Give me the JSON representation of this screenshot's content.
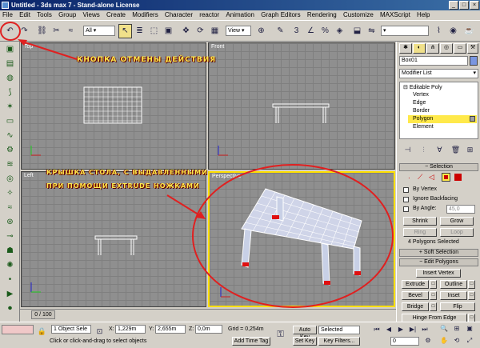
{
  "window": {
    "title": "Untitled - 3ds max 7 - Stand-alone License"
  },
  "menu": [
    "File",
    "Edit",
    "Tools",
    "Group",
    "Views",
    "Create",
    "Modifiers",
    "Character",
    "reactor",
    "Animation",
    "Graph Editors",
    "Rendering",
    "Customize",
    "MAXScript",
    "Help"
  ],
  "toolbar": {
    "selection_filter": "All",
    "ref_coord": "View"
  },
  "viewports": {
    "top": "Top",
    "front": "Front",
    "left": "Left",
    "perspective": "Perspective"
  },
  "annotations": {
    "undo_note": "КНОПКА ОТМЕНЫ ДЕЙСТВИЯ",
    "table_note_line1": "КРЫШКА СТОЛА, С ВЫДАВЛЕННЫМИ",
    "table_note_line2": "ПРИ ПОМОЩИ EXTRUDE НОЖКАМИ"
  },
  "command_panel": {
    "object_name": "Box01",
    "modifier_list": "Modifier List",
    "stack": [
      {
        "label": "Editable Poly",
        "level": 0,
        "selected": false
      },
      {
        "label": "Vertex",
        "level": 1,
        "selected": false
      },
      {
        "label": "Edge",
        "level": 1,
        "selected": false
      },
      {
        "label": "Border",
        "level": 1,
        "selected": false
      },
      {
        "label": "Polygon",
        "level": 1,
        "selected": true
      },
      {
        "label": "Element",
        "level": 1,
        "selected": false
      }
    ],
    "selection": {
      "header": "Selection",
      "by_vertex": "By Vertex",
      "ignore_backfacing": "Ignore Backfacing",
      "by_angle": "By Angle:",
      "angle_value": "45,0",
      "shrink": "Shrink",
      "grow": "Grow",
      "ring": "Ring",
      "loop": "Loop",
      "status": "4 Polygons Selected"
    },
    "soft_selection": {
      "header": "Soft Selection"
    },
    "edit_polygons": {
      "header": "Edit Polygons",
      "insert_vertex": "Insert Vertex",
      "extrude": "Extrude",
      "outline": "Outline",
      "bevel": "Bevel",
      "inset": "Inset",
      "bridge": "Bridge",
      "flip": "Flip",
      "hinge": "Hinge From Edge"
    }
  },
  "timeline": {
    "frame": "0 / 100",
    "progress": 0.0
  },
  "status": {
    "selected": "1 Object Sele",
    "x_label": "X:",
    "x": "1,229m",
    "y_label": "Y:",
    "y": "2,655m",
    "z_label": "Z:",
    "z": "0,0m",
    "grid": "Grid = 0,254m",
    "prompt": "Click or click-and-drag to select objects",
    "add_time_tag": "Add Time Tag",
    "auto_key": "Auto Key",
    "key_mode": "Selected",
    "set_key": "Set Key",
    "key_filters": "Key Filters...",
    "frame_field": "0"
  },
  "colors": {
    "annotation": "#ffe94a",
    "highlight": "#ff2a2a",
    "active_border": "#ffe000",
    "stack_selected": "#ffe94a"
  }
}
